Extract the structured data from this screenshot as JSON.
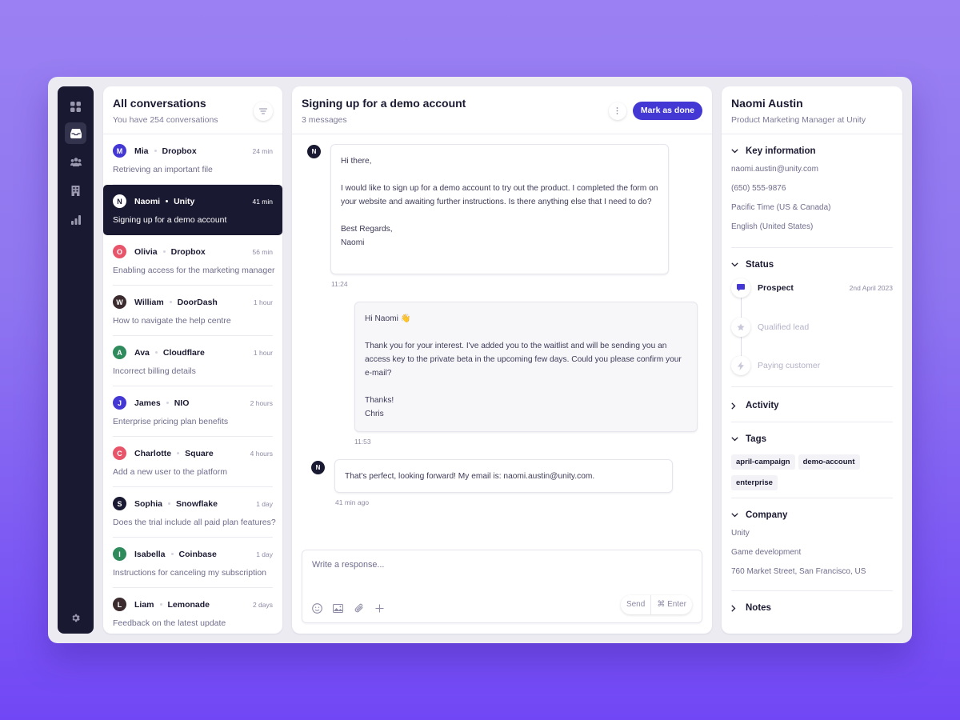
{
  "colors": {
    "accent": "#4338d4",
    "dark": "#1a1932",
    "muted_text": "#6f6d8c"
  },
  "rail": {
    "items": [
      {
        "icon": "grid-icon",
        "label": "Dashboard",
        "active": false
      },
      {
        "icon": "inbox-icon",
        "label": "Inbox",
        "active": true
      },
      {
        "icon": "users-icon",
        "label": "Contacts",
        "active": false
      },
      {
        "icon": "building-icon",
        "label": "Companies",
        "active": false
      },
      {
        "icon": "bar-chart-icon",
        "label": "Reports",
        "active": false
      }
    ],
    "settings_icon": "gear-icon"
  },
  "conversations": {
    "title": "All conversations",
    "subtitle": "You have 254 conversations",
    "filter_icon": "filter-icon",
    "items": [
      {
        "initial": "M",
        "color": "#4338d4",
        "name": "Mia",
        "company": "Dropbox",
        "time": "24 min",
        "subject": "Retrieving an important file",
        "active": false
      },
      {
        "initial": "N",
        "color": "#ffffff",
        "name": "Naomi",
        "company": "Unity",
        "time": "41 min",
        "subject": "Signing up for a demo account",
        "active": true
      },
      {
        "initial": "O",
        "color": "#e8556a",
        "name": "Olivia",
        "company": "Dropbox",
        "time": "56 min",
        "subject": "Enabling access for the marketing manager",
        "active": false
      },
      {
        "initial": "W",
        "color": "#3b2a2e",
        "name": "William",
        "company": "DoorDash",
        "time": "1 hour",
        "subject": "How to navigate the help centre",
        "active": false
      },
      {
        "initial": "A",
        "color": "#2f8a5c",
        "name": "Ava",
        "company": "Cloudflare",
        "time": "1 hour",
        "subject": "Incorrect billing details",
        "active": false
      },
      {
        "initial": "J",
        "color": "#4338d4",
        "name": "James",
        "company": "NIO",
        "time": "2 hours",
        "subject": "Enterprise pricing plan benefits",
        "active": false
      },
      {
        "initial": "C",
        "color": "#e8556a",
        "name": "Charlotte",
        "company": "Square",
        "time": "4 hours",
        "subject": "Add a new user to the platform",
        "active": false
      },
      {
        "initial": "S",
        "color": "#1a1932",
        "name": "Sophia",
        "company": "Snowflake",
        "time": "1 day",
        "subject": "Does the trial include all paid plan features?",
        "active": false
      },
      {
        "initial": "I",
        "color": "#2f8a5c",
        "name": "Isabella",
        "company": "Coinbase",
        "time": "1 day",
        "subject": "Instructions for canceling my subscription",
        "active": false
      },
      {
        "initial": "L",
        "color": "#3b2a2e",
        "name": "Liam",
        "company": "Lemonade",
        "time": "2 days",
        "subject": "Feedback on the latest update",
        "active": false
      }
    ]
  },
  "chat": {
    "title": "Signing up for a demo account",
    "subtitle": "3 messages",
    "more_icon": "kebab-icon",
    "mark_done_label": "Mark as done",
    "messages": [
      {
        "from": "customer",
        "initial": "N",
        "body": "Hi there,\n\nI would like to sign up for a demo account to try out the product. I completed the form on your website and awaiting further instructions. Is there anything else that I need to do?\n\nBest Regards,\nNaomi",
        "time": "11:24"
      },
      {
        "from": "agent",
        "body": "Hi Naomi 👋\n\nThank you for your interest. I've added you to the waitlist and will be sending you an access key to the private beta in the upcoming few days. Could you please confirm your e-mail?\n\nThanks!\nChris",
        "time": "11:53"
      },
      {
        "from": "customer",
        "initial": "N",
        "body": "That's perfect, looking forward! My email is: naomi.austin@unity.com.",
        "time": "41 min ago"
      }
    ],
    "composer": {
      "placeholder": "Write a response...",
      "value": "",
      "tools": [
        "emoji-icon",
        "image-icon",
        "paperclip-icon",
        "plus-icon"
      ],
      "send_label": "Send",
      "shortcut_label": "⌘ Enter"
    }
  },
  "contact": {
    "name": "Naomi Austin",
    "role": "Product Marketing Manager at Unity",
    "key_information": {
      "label": "Key information",
      "expanded": true,
      "email": "naomi.austin@unity.com",
      "phone": "(650) 555-9876",
      "timezone": "Pacific Time (US & Canada)",
      "language": "English (United States)"
    },
    "status": {
      "label": "Status",
      "expanded": true,
      "steps": [
        {
          "label": "Prospect",
          "date": "2nd April 2023",
          "icon": "chat-bubble-icon",
          "current": true
        },
        {
          "label": "Qualified lead",
          "date": "",
          "icon": "star-icon",
          "current": false
        },
        {
          "label": "Paying customer",
          "date": "",
          "icon": "lightning-icon",
          "current": false
        }
      ]
    },
    "activity": {
      "label": "Activity",
      "expanded": false
    },
    "tags": {
      "label": "Tags",
      "expanded": true,
      "items": [
        "april-campaign",
        "demo-account",
        "enterprise"
      ]
    },
    "company": {
      "label": "Company",
      "expanded": true,
      "name": "Unity",
      "industry": "Game development",
      "address": "760 Market Street, San Francisco, US"
    },
    "notes": {
      "label": "Notes",
      "expanded": false
    }
  }
}
